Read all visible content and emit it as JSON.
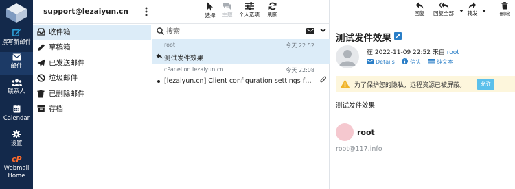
{
  "colors": {
    "nav_bg": "#13294b",
    "accent": "#2a7ec7",
    "selected_row": "#dcecf8",
    "warning_bg": "#fdf6dc",
    "allow_button": "#5bc0eb",
    "cpanel_orange": "#ff6c2c"
  },
  "nav": {
    "compose": {
      "label": "撰写新邮件",
      "icon": "compose-icon"
    },
    "mail": {
      "label": "邮件",
      "icon": "envelope-icon"
    },
    "contacts": {
      "label": "联系人",
      "icon": "contacts-icon"
    },
    "calendar": {
      "label": "Calendar",
      "icon": "calendar-icon"
    },
    "settings": {
      "label": "设置",
      "icon": "gear-icon"
    },
    "webmail_home": {
      "label_line1": "Webmail",
      "label_line2": "Home",
      "icon": "cpanel-icon"
    }
  },
  "account": {
    "email": "support@lezaiyun.cn"
  },
  "folders": [
    {
      "label": "收件箱",
      "icon": "inbox-icon",
      "active": true
    },
    {
      "label": "草稿箱",
      "icon": "pencil-icon"
    },
    {
      "label": "已发送邮件",
      "icon": "paper-plane-icon"
    },
    {
      "label": "垃圾邮件",
      "icon": "ban-icon"
    },
    {
      "label": "已删除邮件",
      "icon": "trash-icon"
    },
    {
      "label": "存档",
      "icon": "archive-icon"
    }
  ],
  "list_toolbar": {
    "select": "选择",
    "thread": "主题",
    "options": "个人选项",
    "refresh": "刷新"
  },
  "search": {
    "placeholder": "搜索"
  },
  "messages": [
    {
      "from": "root",
      "date": "今天 22:52",
      "subject": "测试发件效果",
      "replied": true,
      "selected": true
    },
    {
      "from": "cPanel on lezaiyun.cn",
      "date": "今天 22:08",
      "subject": "[lezaiyun.cn] Client configuration settings for \"support@lezaiyun.cn\"",
      "unread": true,
      "attachment": true
    }
  ],
  "preview_toolbar": {
    "reply": "回复",
    "reply_all": "回复全部",
    "forward": "转发",
    "delete": "删除"
  },
  "mail": {
    "subject": "测试发件效果",
    "date_prefix": "在 2022-11-09 22:52 来自",
    "sender": "root",
    "details": "Details",
    "headers": "信头",
    "plain_text": "纯文本",
    "privacy_notice": "为了保护您的隐私，远程资源已被屏蔽。",
    "allow": "允许",
    "body": "测试发件效果",
    "signature_name": "root",
    "signature_email": "root@117.info"
  }
}
